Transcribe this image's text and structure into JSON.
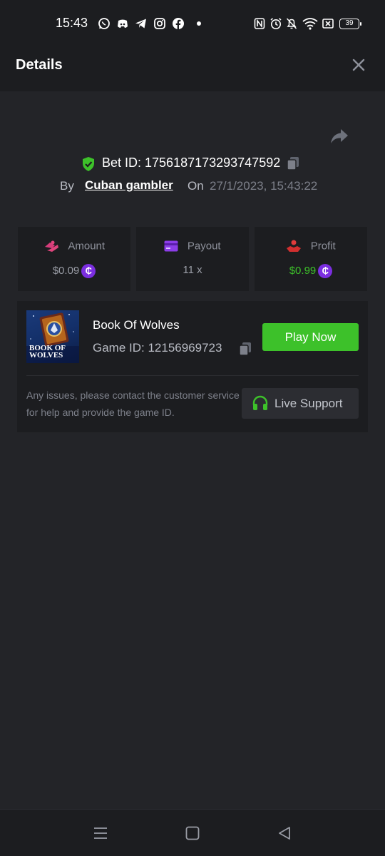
{
  "status_bar": {
    "time": "15:43",
    "notification_icons": [
      "whatsapp-icon",
      "discord-icon",
      "telegram-icon",
      "instagram-icon",
      "facebook-icon",
      "more-dot-icon"
    ],
    "system_icons": [
      "nfc-icon",
      "alarm-icon",
      "mute-icon",
      "wifi-icon",
      "sim-off-icon"
    ],
    "battery": "39"
  },
  "header": {
    "title": "Details",
    "close_icon": "close-icon"
  },
  "bet": {
    "id_label": "Bet ID: 1756187173293747592",
    "by_label": "By",
    "user": "Cuban gambler",
    "on_label": "On",
    "datetime": "27/1/2023, 15:43:22"
  },
  "stats": [
    {
      "label": "Amount",
      "value": "$0.09",
      "icon": "amount-hand-icon",
      "value_color": "#9a9da6",
      "has_coin": true
    },
    {
      "label": "Payout",
      "value": "11 x",
      "icon": "card-icon",
      "value_color": "#9a9da6",
      "has_coin": false
    },
    {
      "label": "Profit",
      "value": "$0.99",
      "icon": "profit-hand-icon",
      "value_color": "#3dc12a",
      "has_coin": true
    }
  ],
  "coin_symbol": "₵",
  "game": {
    "name": "Book Of Wolves",
    "id_label": "Game ID: 12156969723",
    "thumb_text": "BOOK OF WOLVES",
    "play_label": "Play Now"
  },
  "support": {
    "text": "Any issues, please contact the customer service for help and provide the game ID.",
    "button_label": "Live Support"
  },
  "colors": {
    "accent_green": "#3dc12a",
    "coin_purple": "#7b2ee0",
    "background": "#232428",
    "panel": "#1c1d20"
  },
  "nav": [
    "menu-icon",
    "home-icon",
    "back-icon"
  ]
}
